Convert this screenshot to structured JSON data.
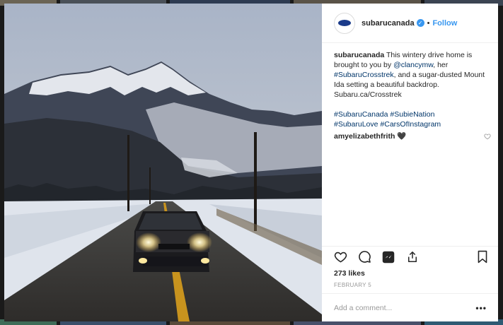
{
  "post": {
    "username": "subarucanada",
    "follow_label": "Follow",
    "dot_separator": "•",
    "verified_glyph": "✓",
    "caption": {
      "username": "subarucanada",
      "text_1": "This wintery drive home is brought to you by ",
      "mention": "@clancymw",
      "text_2": ", her ",
      "hashtag_1": "#SubaruCrosstrek",
      "text_3": ", and a sugar-dusted Mount Ida setting a beautiful backdrop. Subaru.ca/Crosstrek"
    },
    "hashtags": [
      "#SubaruCanada",
      "#SubieNation",
      "#SubaruLove",
      "#CarsOfInstagram"
    ],
    "comments": [
      {
        "username": "amyelizabethfrith",
        "text": "🖤"
      }
    ],
    "likes": "273 likes",
    "date": "FEBRUARY 5",
    "add_comment_placeholder": "Add a comment...",
    "more_glyph": "•••"
  },
  "icons": {
    "like": "heart-icon",
    "comment": "comment-icon",
    "dm": "direct-message-icon",
    "share": "share-icon",
    "save": "bookmark-icon",
    "comment_like": "heart-outline-icon"
  },
  "colors": {
    "accent": "#3897f0",
    "link": "#003569",
    "text": "#262626",
    "muted": "#999999"
  }
}
